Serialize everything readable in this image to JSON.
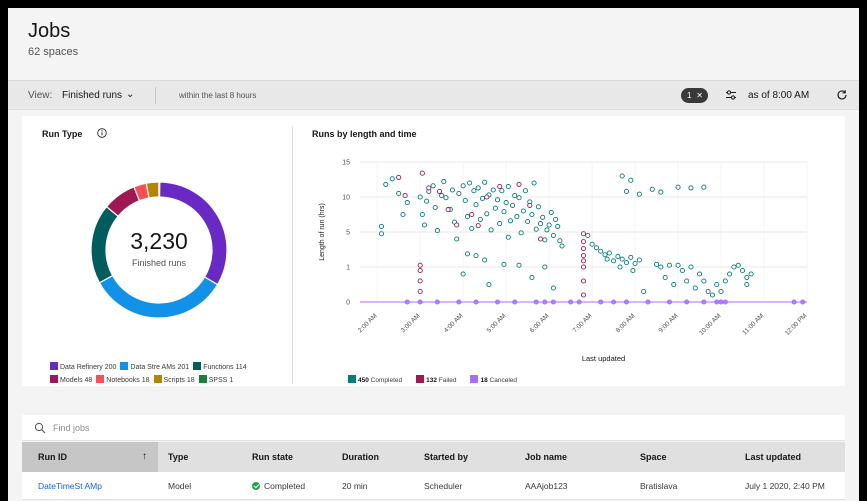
{
  "header": {
    "title": "Jobs",
    "subtitle": "62 spaces"
  },
  "toolbar": {
    "view_label": "View:",
    "view_value": "Finished runs",
    "range_text": "within the last 8 hours",
    "filter_count": "1",
    "as_of": "as of 8:00 AM"
  },
  "run_type": {
    "title": "Run Type",
    "total": "3,230",
    "total_caption": "Finished runs",
    "legend_row1": [
      {
        "label": "Data Refinery",
        "value": "200",
        "color": "#6929c4"
      },
      {
        "label": "Data Stre AMs",
        "value": "201",
        "color": "#1192e8"
      },
      {
        "label": "Functions",
        "value": "114",
        "color": "#005d5d"
      }
    ],
    "legend_row2": [
      {
        "label": "Models",
        "value": "48",
        "color": "#9f1853"
      },
      {
        "label": "Notebooks",
        "value": "18",
        "color": "#fa4d56"
      },
      {
        "label": "Scripts",
        "value": "18",
        "color": "#b28600"
      },
      {
        "label": "SPSS",
        "value": "1",
        "color": "#198038"
      }
    ],
    "donut_colors": [
      "#6929c4",
      "#1192e8",
      "#005d5d",
      "#9f1853",
      "#fa4d56",
      "#b28600",
      "#198038"
    ]
  },
  "chart_data": {
    "type": "scatter",
    "title": "Runs by length and time",
    "xlabel": "Last updated",
    "ylabel": "Length of run (hrs)",
    "x_ticks": [
      "2:00 AM",
      "3:00 AM",
      "4:00 AM",
      "5:00 AM",
      "6:00 AM",
      "7:00 AM",
      "8:00 AM",
      "9:00 AM",
      "10:00 AM",
      "11:00 AM",
      "12:00 PM"
    ],
    "y_tick_labels": [
      "0",
      "1",
      "5",
      "10",
      "15"
    ],
    "y_tick_values": [
      0,
      1,
      5,
      10,
      15
    ],
    "grid": true,
    "legend": "bottom",
    "series": [
      {
        "name": "Completed",
        "count": "450",
        "color": "#007d79",
        "points": [
          [
            2.1,
            5.8
          ],
          [
            2.2,
            11.8
          ],
          [
            2.35,
            12.6
          ],
          [
            2.5,
            10.5
          ],
          [
            2.7,
            9.2
          ],
          [
            2.6,
            7.5
          ],
          [
            2.1,
            4.8
          ],
          [
            3.0,
            10.0
          ],
          [
            3.05,
            7.5
          ],
          [
            3.1,
            6.0
          ],
          [
            3.15,
            9.4
          ],
          [
            3.2,
            10.8
          ],
          [
            3.3,
            11.6
          ],
          [
            3.35,
            8.5
          ],
          [
            3.4,
            5.2
          ],
          [
            3.5,
            10.2
          ],
          [
            3.55,
            12.2
          ],
          [
            3.6,
            9.9
          ],
          [
            3.7,
            8.2
          ],
          [
            3.75,
            11.0
          ],
          [
            3.8,
            6.4
          ],
          [
            3.85,
            4.2
          ],
          [
            3.9,
            10.5
          ],
          [
            4.0,
            11.6
          ],
          [
            4.05,
            9.5
          ],
          [
            4.1,
            7.2
          ],
          [
            4.15,
            12.0
          ],
          [
            4.2,
            5.5
          ],
          [
            4.25,
            10.9
          ],
          [
            4.3,
            8.9
          ],
          [
            4.35,
            11.3
          ],
          [
            4.4,
            6.8
          ],
          [
            4.45,
            9.8
          ],
          [
            4.5,
            12.1
          ],
          [
            4.55,
            7.6
          ],
          [
            4.6,
            10.3
          ],
          [
            4.65,
            5.3
          ],
          [
            4.7,
            11.0
          ],
          [
            4.75,
            8.4
          ],
          [
            4.8,
            9.6
          ],
          [
            4.85,
            6.2
          ],
          [
            4.9,
            10.9
          ],
          [
            4.95,
            7.9
          ],
          [
            5.0,
            9.2
          ],
          [
            5.05,
            11.5
          ],
          [
            5.1,
            6.6
          ],
          [
            5.15,
            8.8
          ],
          [
            5.2,
            10.2
          ],
          [
            5.25,
            7.2
          ],
          [
            5.3,
            9.9
          ],
          [
            5.35,
            4.9
          ],
          [
            5.4,
            8.0
          ],
          [
            5.45,
            10.9
          ],
          [
            5.5,
            6.5
          ],
          [
            5.55,
            9.3
          ],
          [
            5.6,
            7.5
          ],
          [
            5.65,
            12.0
          ],
          [
            5.7,
            5.4
          ],
          [
            5.75,
            8.6
          ],
          [
            5.8,
            6.2
          ],
          [
            5.85,
            7.1
          ],
          [
            5.9,
            4.1
          ],
          [
            5.95,
            5.3
          ],
          [
            6.0,
            6.0
          ],
          [
            6.05,
            7.8
          ],
          [
            6.1,
            4.6
          ],
          [
            6.15,
            6.8
          ],
          [
            6.2,
            5.8
          ],
          [
            6.25,
            4.0
          ],
          [
            6.3,
            3.4
          ],
          [
            4.3,
            2.3
          ],
          [
            4.1,
            2.5
          ],
          [
            4.5,
            1.8
          ],
          [
            4.0,
            0.8
          ],
          [
            4.6,
            0.5
          ],
          [
            5.3,
            1.2
          ],
          [
            5.6,
            0.7
          ],
          [
            5.9,
            1.0
          ],
          [
            6.1,
            0.4
          ],
          [
            5.05,
            4.4
          ],
          [
            4.95,
            1.3
          ],
          [
            6.9,
            4.6
          ],
          [
            7.0,
            3.6
          ],
          [
            7.1,
            3.2
          ],
          [
            7.2,
            2.8
          ],
          [
            7.3,
            2.4
          ],
          [
            7.35,
            1.9
          ],
          [
            7.4,
            2.6
          ],
          [
            7.5,
            1.7
          ],
          [
            7.6,
            2.2
          ],
          [
            7.7,
            1.9
          ],
          [
            7.8,
            1.5
          ],
          [
            7.9,
            2.1
          ],
          [
            8.0,
            1.4
          ],
          [
            7.65,
            1.0
          ],
          [
            7.95,
            0.9
          ],
          [
            8.2,
            0.3
          ],
          [
            8.1,
            1.8
          ],
          [
            8.5,
            1.3
          ],
          [
            8.6,
            1.0
          ],
          [
            8.7,
            0.7
          ],
          [
            8.8,
            1.2
          ],
          [
            8.9,
            0.5
          ],
          [
            9.0,
            1.2
          ],
          [
            9.1,
            0.9
          ],
          [
            9.2,
            0.6
          ],
          [
            9.3,
            1.0
          ],
          [
            9.4,
            0.4
          ],
          [
            9.5,
            0.8
          ],
          [
            9.6,
            0.6
          ],
          [
            9.7,
            0.3
          ],
          [
            9.8,
            0.2
          ],
          [
            9.9,
            0.5
          ],
          [
            10.0,
            0.3
          ],
          [
            10.1,
            0.6
          ],
          [
            10.2,
            0.8
          ],
          [
            10.3,
            1.0
          ],
          [
            10.4,
            1.2
          ],
          [
            10.5,
            0.9
          ],
          [
            10.6,
            0.7
          ],
          [
            7.9,
            12.4
          ],
          [
            7.7,
            13.0
          ],
          [
            7.8,
            10.8
          ],
          [
            8.1,
            10.4
          ],
          [
            8.4,
            11.1
          ],
          [
            8.6,
            10.7
          ],
          [
            9.0,
            11.4
          ],
          [
            9.3,
            11.3
          ],
          [
            9.6,
            11.4
          ],
          [
            10.6,
            0.5
          ],
          [
            10.7,
            0.8
          ]
        ]
      },
      {
        "name": "Failed",
        "count": "132",
        "color": "#9f1853",
        "points": [
          [
            2.5,
            12.8
          ],
          [
            2.65,
            10.2
          ],
          [
            3.05,
            13.4
          ],
          [
            3.2,
            11.3
          ],
          [
            3.45,
            10.8
          ],
          [
            3.65,
            8.2
          ],
          [
            3.85,
            6.0
          ],
          [
            4.2,
            7.5
          ],
          [
            4.35,
            5.9
          ],
          [
            4.55,
            10.0
          ],
          [
            4.85,
            11.5
          ],
          [
            5.3,
            11.8
          ],
          [
            5.55,
            8.8
          ],
          [
            5.8,
            4.2
          ],
          [
            6.8,
            4.8
          ],
          [
            6.8,
            3.9
          ],
          [
            6.8,
            3.1
          ],
          [
            6.8,
            2.3
          ],
          [
            6.8,
            1.7
          ],
          [
            6.8,
            1.0
          ],
          [
            6.8,
            0.6
          ],
          [
            6.8,
            0.2
          ],
          [
            3.0,
            0.3
          ],
          [
            3.0,
            0.6
          ],
          [
            3.0,
            0.9
          ],
          [
            3.0,
            1.2
          ]
        ]
      },
      {
        "name": "Canceled",
        "count": "18",
        "color": "#a56eff",
        "points": [
          [
            2.7,
            0
          ],
          [
            3.0,
            0
          ],
          [
            3.4,
            0
          ],
          [
            3.9,
            0
          ],
          [
            4.3,
            0
          ],
          [
            4.8,
            0
          ],
          [
            5.2,
            0
          ],
          [
            5.7,
            0
          ],
          [
            5.9,
            0
          ],
          [
            6.1,
            0
          ],
          [
            6.5,
            0
          ],
          [
            6.7,
            0
          ],
          [
            7.2,
            0
          ],
          [
            7.5,
            0
          ],
          [
            7.8,
            0
          ],
          [
            8.3,
            0
          ],
          [
            8.8,
            0
          ],
          [
            9.2,
            0
          ],
          [
            9.6,
            0
          ],
          [
            9.9,
            0
          ],
          [
            10.0,
            0
          ],
          [
            10.1,
            0
          ],
          [
            11.7,
            0
          ],
          [
            11.9,
            0
          ]
        ]
      }
    ],
    "xlim": [
      1.6,
      12.0
    ],
    "ylim": [
      0,
      15
    ]
  },
  "search": {
    "placeholder": "Find jobs"
  },
  "table": {
    "headers": [
      "Run ID",
      "Type",
      "Run state",
      "Duration",
      "Started by",
      "Job name",
      "Space",
      "Last updated"
    ],
    "rows": [
      {
        "run_id": "DateTimeSt AMp",
        "type": "Model",
        "run_state": "Completed",
        "duration": "20 min",
        "started_by": "Scheduler",
        "job_name": "AAAjob123",
        "space": "Bratislava",
        "last_updated": "July 1 2020, 2:40 PM"
      }
    ]
  }
}
